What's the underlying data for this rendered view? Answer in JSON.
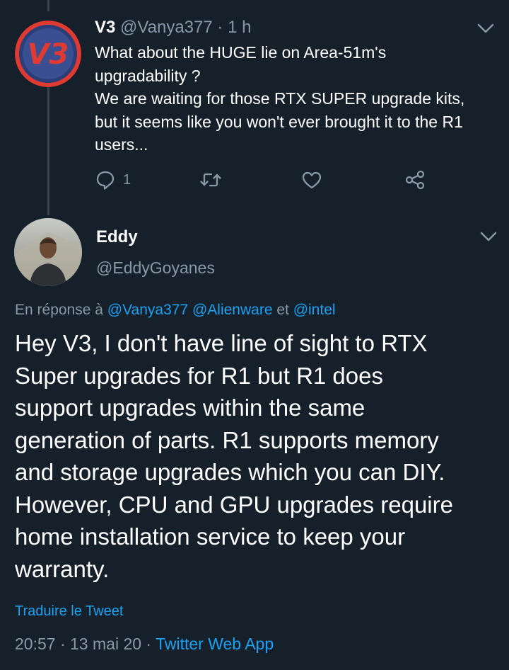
{
  "tweet1": {
    "name": "V3",
    "handle": "@Vanya377",
    "separator": "·",
    "time": "1 h",
    "avatar_text": "V3",
    "lines": [
      "What about the HUGE lie on Area-51m's",
      "upgradability ?",
      "We are waiting for those RTX SUPER upgrade kits,",
      "but it seems like you won't ever brought it to the R1",
      "users..."
    ],
    "reply_count": "1",
    "icons": {
      "reply": "reply-icon",
      "retweet": "retweet-icon",
      "like": "heart-icon",
      "share": "share-icon",
      "menu": "chevron-down-icon"
    }
  },
  "tweet2": {
    "name": "Eddy",
    "handle": "@EddyGoyanes",
    "replying_prefix": "En réponse à",
    "mention1": "@Vanya377",
    "mention2": "@Alienware",
    "conjunction": "et",
    "mention3": "@intel",
    "lines": [
      "Hey V3, I don't have line of sight to RTX",
      "Super upgrades for R1 but R1 does",
      "support upgrades within the same",
      "generation of parts. R1 supports memory",
      "and storage upgrades which you can DIY.",
      "However, CPU and GPU upgrades require",
      "home installation service to keep your",
      "warranty."
    ],
    "translate_label": "Traduire le Tweet",
    "time": "20:57",
    "date": "13 mai 20",
    "separator": "·",
    "source": "Twitter Web App"
  },
  "colors": {
    "background": "#15202b",
    "muted": "#8899a6",
    "link": "#1da1f2",
    "thread_line": "#38444d",
    "avatar_ring": "#e03a33"
  }
}
